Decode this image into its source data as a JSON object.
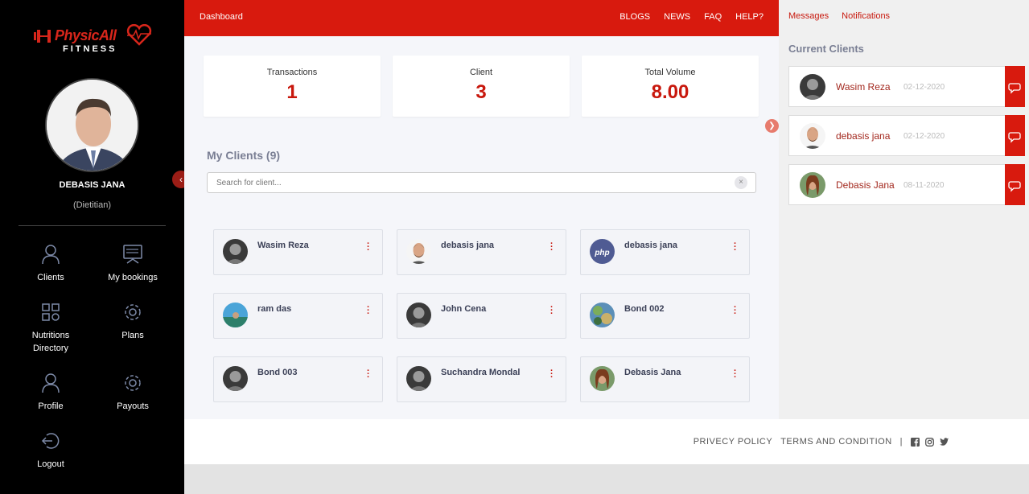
{
  "sidebar": {
    "logo_text": "PhysicAll",
    "logo_sub": "FITNESS",
    "user_name": "DEBASIS JANA",
    "user_role": "(Dietitian)",
    "nav": {
      "clients": "Clients",
      "bookings": "My bookings",
      "nutritions_1": "Nutritions",
      "nutritions_2": "Directory",
      "plans": "Plans",
      "profile": "Profile",
      "payouts": "Payouts",
      "logout": "Logout"
    }
  },
  "header": {
    "breadcrumb": "Dashboard",
    "menu": [
      "BLOGS",
      "NEWS",
      "FAQ",
      "HELP?"
    ]
  },
  "stats": [
    {
      "label": "Transactions",
      "value": "1"
    },
    {
      "label": "Client",
      "value": "3"
    },
    {
      "label": "Total Volume",
      "value": "8.00"
    }
  ],
  "clients": {
    "title": "My Clients (9)",
    "search_placeholder": "Search for client...",
    "items": [
      {
        "name": "Wasim Reza"
      },
      {
        "name": "debasis jana"
      },
      {
        "name": "debasis jana"
      },
      {
        "name": "ram das"
      },
      {
        "name": "John Cena"
      },
      {
        "name": "Bond 002"
      },
      {
        "name": "Bond 003"
      },
      {
        "name": "Suchandra Mondal"
      },
      {
        "name": "Debasis Jana"
      }
    ]
  },
  "right_panel": {
    "tabs": [
      "Messages",
      "Notifications"
    ],
    "title": "Current Clients",
    "items": [
      {
        "name": "Wasim Reza",
        "date": "02-12-2020"
      },
      {
        "name": "debasis jana",
        "date": "02-12-2020"
      },
      {
        "name": "Debasis Jana",
        "date": "08-11-2020"
      }
    ]
  },
  "footer": {
    "links": [
      "PRIVECY POLICY",
      "TERMS AND CONDITION",
      "|"
    ]
  },
  "colors": {
    "brand_red": "#d81a0e",
    "sidebar_bg": "#000000"
  }
}
